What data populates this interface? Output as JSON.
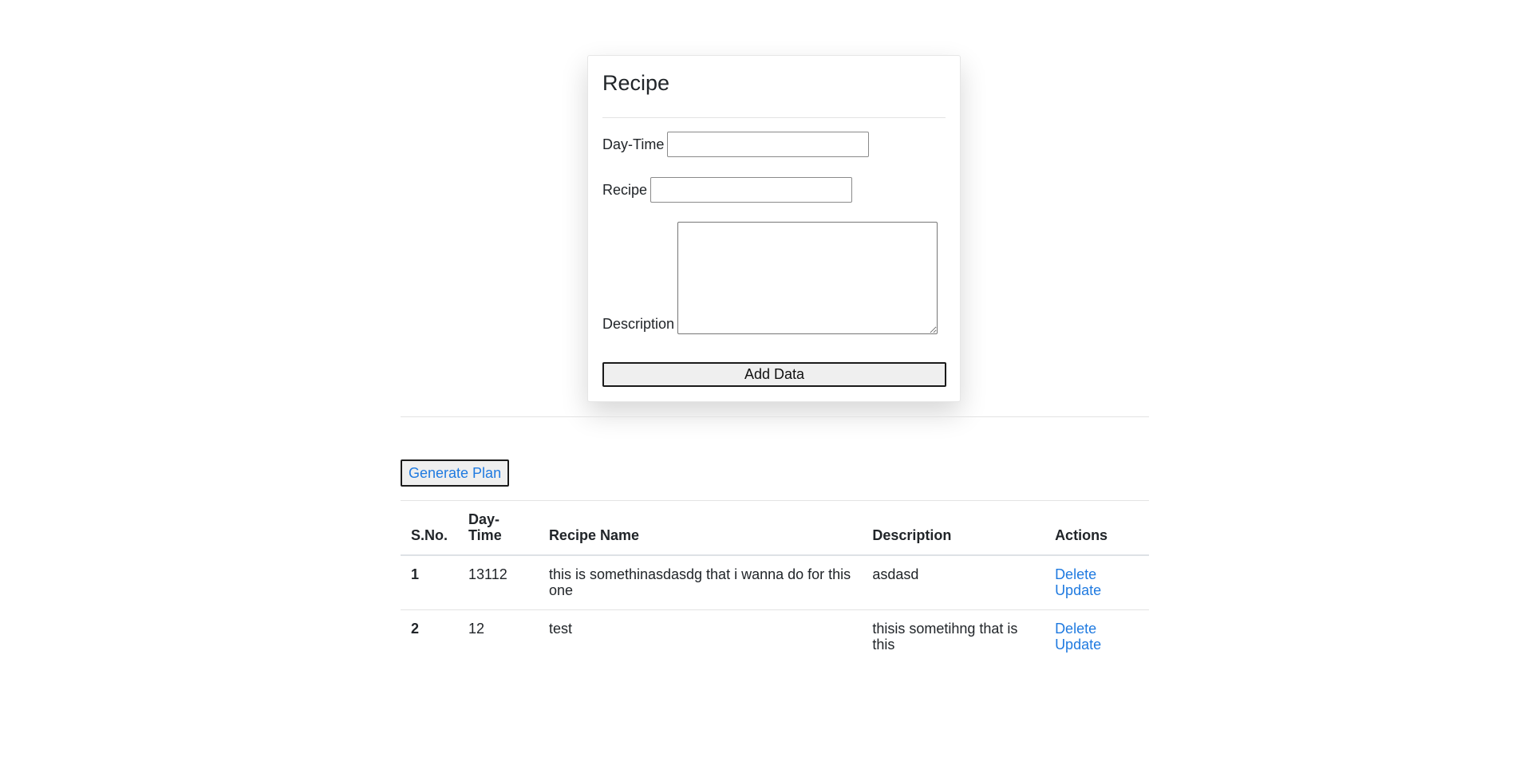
{
  "form": {
    "title": "Recipe",
    "daytime_label": "Day-Time",
    "daytime_value": "",
    "recipe_label": "Recipe",
    "recipe_value": "",
    "description_label": "Description",
    "description_value": "",
    "submit_label": "Add Data"
  },
  "plan": {
    "generate_label": "Generate Plan"
  },
  "table": {
    "headers": {
      "sno": "S.No.",
      "daytime": "Day-Time",
      "recipe_name": "Recipe Name",
      "description": "Description",
      "actions": "Actions"
    },
    "rows": [
      {
        "sno": "1",
        "daytime": "13112",
        "recipe_name": "this is somethinasdasdg that i wanna do for this one",
        "description": "asdasd",
        "delete_label": "Delete",
        "update_label": "Update"
      },
      {
        "sno": "2",
        "daytime": "12",
        "recipe_name": "test",
        "description": "thisis sometihng that is this",
        "delete_label": "Delete",
        "update_label": "Update"
      }
    ]
  },
  "colors": {
    "link": "#1f7ae0",
    "button_bg": "#efefef",
    "button_border": "#1a1a1a",
    "divider": "#e3e3e3"
  }
}
